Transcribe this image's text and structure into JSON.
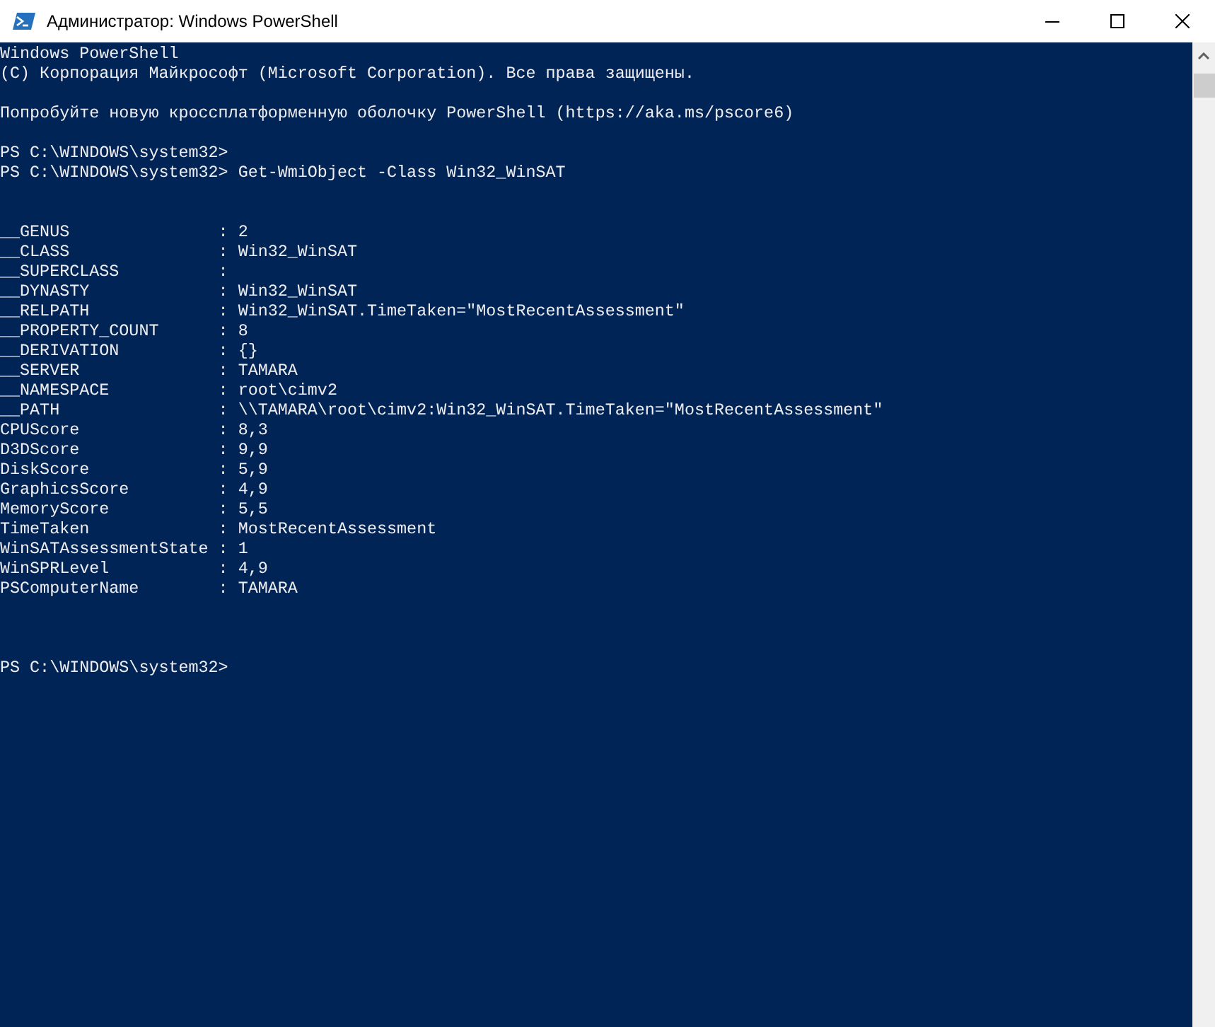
{
  "window": {
    "title": "Администратор: Windows PowerShell"
  },
  "console": {
    "lines": [
      {
        "kind": "text",
        "text": "Windows PowerShell"
      },
      {
        "kind": "text",
        "text": "(C) Корпорация Майкрософт (Microsoft Corporation). Все права защищены."
      },
      {
        "kind": "blank"
      },
      {
        "kind": "text",
        "text": "Попробуйте новую кроссплатформенную оболочку PowerShell (https://aka.ms/pscore6)"
      },
      {
        "kind": "blank"
      },
      {
        "kind": "text",
        "text": "PS C:\\WINDOWS\\system32>"
      },
      {
        "kind": "text",
        "text": "PS C:\\WINDOWS\\system32> Get-WmiObject -Class Win32_WinSAT"
      },
      {
        "kind": "blank"
      },
      {
        "kind": "blank"
      },
      {
        "kind": "text",
        "text": "__GENUS               : 2"
      },
      {
        "kind": "text",
        "text": "__CLASS               : Win32_WinSAT"
      },
      {
        "kind": "text",
        "text": "__SUPERCLASS          :"
      },
      {
        "kind": "text",
        "text": "__DYNASTY             : Win32_WinSAT"
      },
      {
        "kind": "text",
        "text": "__RELPATH             : Win32_WinSAT.TimeTaken=\"MostRecentAssessment\""
      },
      {
        "kind": "text",
        "text": "__PROPERTY_COUNT      : 8"
      },
      {
        "kind": "text",
        "text": "__DERIVATION          : {}"
      },
      {
        "kind": "text",
        "text": "__SERVER              : TAMARA"
      },
      {
        "kind": "text",
        "text": "__NAMESPACE           : root\\cimv2"
      },
      {
        "kind": "text",
        "text": "__PATH                : \\\\TAMARA\\root\\cimv2:Win32_WinSAT.TimeTaken=\"MostRecentAssessment\""
      },
      {
        "kind": "text",
        "text": "CPUScore              : 8,3"
      },
      {
        "kind": "text",
        "text": "D3DScore              : 9,9"
      },
      {
        "kind": "text",
        "text": "DiskScore             : 5,9"
      },
      {
        "kind": "text",
        "text": "GraphicsScore         : 4,9"
      },
      {
        "kind": "text",
        "text": "MemoryScore           : 5,5"
      },
      {
        "kind": "text",
        "text": "TimeTaken             : MostRecentAssessment"
      },
      {
        "kind": "text",
        "text": "WinSATAssessmentState : 1"
      },
      {
        "kind": "text",
        "text": "WinSPRLevel           : 4,9"
      },
      {
        "kind": "text",
        "text": "PSComputerName        : TAMARA"
      },
      {
        "kind": "blank"
      },
      {
        "kind": "blank"
      },
      {
        "kind": "blank"
      },
      {
        "kind": "text",
        "text": "PS C:\\WINDOWS\\system32>"
      }
    ]
  }
}
